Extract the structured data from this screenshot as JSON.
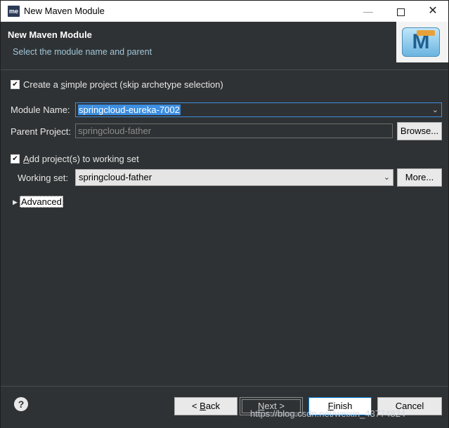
{
  "window": {
    "app_icon": "me",
    "title": "New Maven Module",
    "minimize": "—",
    "close": "✕"
  },
  "banner": {
    "title": "New Maven Module",
    "description": "Select the module name and parent",
    "logo_letter": "M"
  },
  "form": {
    "simple_project": {
      "checked": true,
      "label_prefix": "Create a ",
      "label_mnemonic": "s",
      "label_rest": "imple project (skip archetype selection)"
    },
    "module_name": {
      "label": "Module Name:",
      "value": "springcloud-eureka-7002"
    },
    "parent_project": {
      "label": "Parent Project:",
      "value": "springcloud-father",
      "browse": "Browse..."
    },
    "working_set_toggle": {
      "checked": true,
      "label_mnemonic": "A",
      "label_rest": "dd project(s) to working set"
    },
    "working_set": {
      "label": "Working set:",
      "value": "springcloud-father",
      "more": "More..."
    },
    "advanced": {
      "label": "Advanced"
    }
  },
  "footer": {
    "help": "?",
    "back_prefix": "< ",
    "back_mnemonic": "B",
    "back_rest": "ack",
    "next_mnemonic": "N",
    "next_rest": "ext >",
    "finish_mnemonic": "F",
    "finish_rest": "inish",
    "cancel": "Cancel"
  },
  "watermark": "https://blog.csdn.net/weixin_43774824",
  "icons": {
    "checkbox": "check-icon",
    "dropdown": "chevron-down-icon",
    "expand": "triangle-right-icon",
    "help": "help-icon"
  }
}
